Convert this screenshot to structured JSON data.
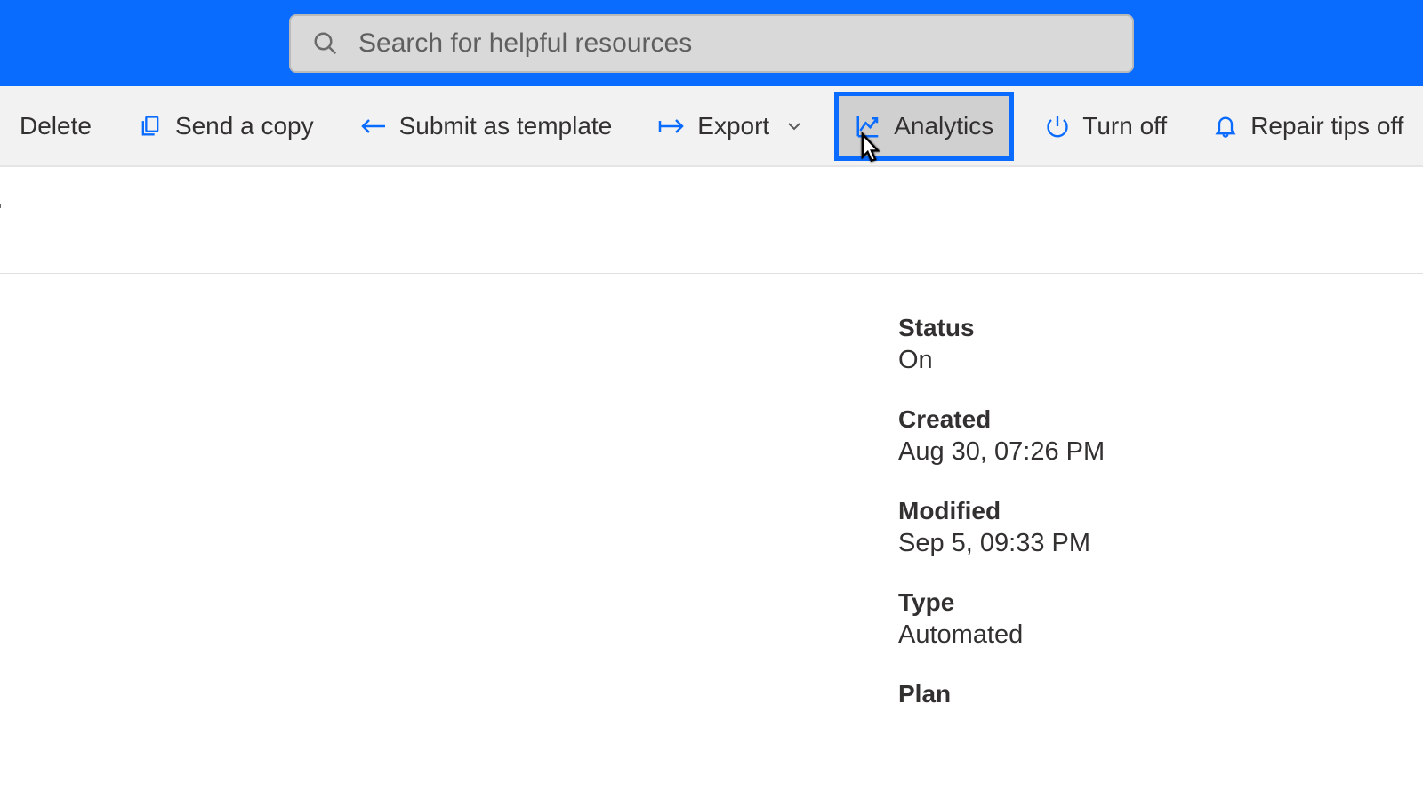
{
  "search": {
    "placeholder": "Search for helpful resources"
  },
  "commands": {
    "delete": "Delete",
    "send_copy": "Send a copy",
    "submit_template": "Submit as template",
    "export": "Export",
    "analytics": "Analytics",
    "turn_off": "Turn off",
    "repair_tips_off": "Repair tips off"
  },
  "heading_fragment": "r",
  "details": {
    "status": {
      "label": "Status",
      "value": "On"
    },
    "created": {
      "label": "Created",
      "value": "Aug 30, 07:26 PM"
    },
    "modified": {
      "label": "Modified",
      "value": "Sep 5, 09:33 PM"
    },
    "type": {
      "label": "Type",
      "value": "Automated"
    },
    "plan": {
      "label": "Plan",
      "value": ""
    }
  },
  "colors": {
    "accent": "#0a6cff",
    "icon": "#0a6cff"
  }
}
